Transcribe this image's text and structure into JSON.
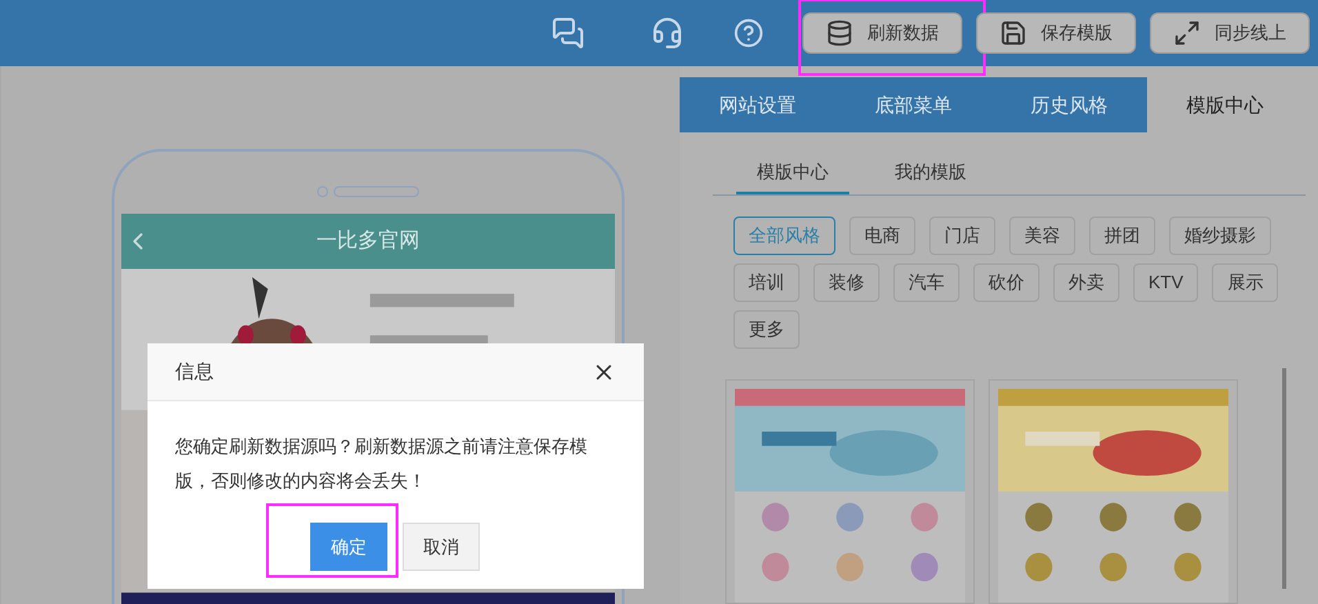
{
  "header": {
    "buttons": [
      {
        "label": "刷新数据",
        "kind": "refresh",
        "highlighted": true
      },
      {
        "label": "保存模版",
        "kind": "save",
        "highlighted": false
      },
      {
        "label": "同步线上",
        "kind": "sync",
        "highlighted": false
      }
    ]
  },
  "panel_tabs": [
    {
      "label": "网站设置",
      "selected": false
    },
    {
      "label": "底部菜单",
      "selected": false
    },
    {
      "label": "历史风格",
      "selected": false
    },
    {
      "label": "模版中心",
      "selected": true
    }
  ],
  "sub_tabs": [
    {
      "label": "模版中心",
      "selected": true
    },
    {
      "label": "我的模版",
      "selected": false
    }
  ],
  "categories": [
    {
      "label": "全部风格",
      "selected": true
    },
    {
      "label": "电商",
      "selected": false
    },
    {
      "label": "门店",
      "selected": false
    },
    {
      "label": "美容",
      "selected": false
    },
    {
      "label": "拼团",
      "selected": false
    },
    {
      "label": "婚纱摄影",
      "selected": false
    },
    {
      "label": "培训",
      "selected": false
    },
    {
      "label": "装修",
      "selected": false
    },
    {
      "label": "汽车",
      "selected": false
    },
    {
      "label": "砍价",
      "selected": false
    },
    {
      "label": "外卖",
      "selected": false
    },
    {
      "label": "KTV",
      "selected": false
    },
    {
      "label": "展示",
      "selected": false
    },
    {
      "label": "更多",
      "selected": false
    }
  ],
  "phone": {
    "title": "一比多官网"
  },
  "dialog": {
    "title": "信息",
    "message": "您确定刷新数据源吗？刷新数据源之前请注意保存模版，否则修改的内容将会丢失！",
    "buttons": [
      {
        "label": "确定",
        "kind": "primary",
        "highlighted": true
      },
      {
        "label": "取消",
        "kind": "secondary",
        "highlighted": false
      }
    ]
  }
}
